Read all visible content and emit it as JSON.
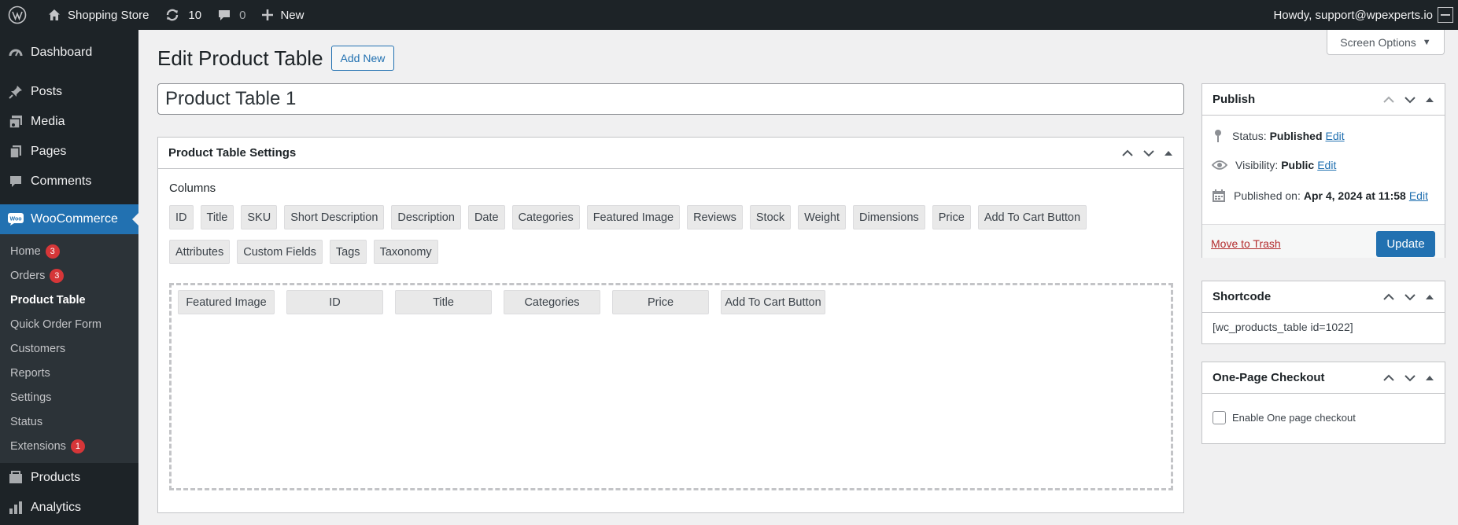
{
  "adminbar": {
    "site_name": "Shopping Store",
    "updates_count": "10",
    "comments_count": "0",
    "new_label": "New",
    "howdy": "Howdy, support@wpexperts.io"
  },
  "sidebar": {
    "items": [
      {
        "label": "Dashboard",
        "icon": "dashboard-icon"
      },
      {
        "label": "Posts",
        "icon": "pin-icon"
      },
      {
        "label": "Media",
        "icon": "media-icon"
      },
      {
        "label": "Pages",
        "icon": "pages-icon"
      },
      {
        "label": "Comments",
        "icon": "comment-icon"
      },
      {
        "label": "WooCommerce",
        "icon": "woo-icon"
      },
      {
        "label": "Products",
        "icon": "products-icon"
      },
      {
        "label": "Analytics",
        "icon": "analytics-icon"
      }
    ],
    "submenu": [
      {
        "label": "Home",
        "badge": "3"
      },
      {
        "label": "Orders",
        "badge": "3"
      },
      {
        "label": "Product Table"
      },
      {
        "label": "Quick Order Form"
      },
      {
        "label": "Customers"
      },
      {
        "label": "Reports"
      },
      {
        "label": "Settings"
      },
      {
        "label": "Status"
      },
      {
        "label": "Extensions",
        "badge": "1"
      }
    ]
  },
  "screen_options": "Screen Options",
  "page": {
    "title": "Edit Product Table",
    "add_new": "Add New",
    "post_title": "Product Table 1"
  },
  "settings": {
    "header": "Product Table Settings",
    "columns_label": "Columns",
    "available_row1": [
      "ID",
      "Title",
      "SKU",
      "Short Description",
      "Description",
      "Date",
      "Categories",
      "Featured Image",
      "Reviews",
      "Stock",
      "Weight",
      "Dimensions",
      "Price",
      "Add To Cart Button"
    ],
    "available_row2": [
      "Attributes",
      "Custom Fields",
      "Tags",
      "Taxonomy"
    ],
    "selected": [
      "Featured Image",
      "ID",
      "Title",
      "Categories",
      "Price",
      "Add To Cart Button"
    ]
  },
  "publish": {
    "header": "Publish",
    "status_label": "Status:",
    "status_value": "Published",
    "visibility_label": "Visibility:",
    "visibility_value": "Public",
    "published_label": "Published on:",
    "published_value": "Apr 4, 2024 at 11:58",
    "edit": "Edit",
    "trash": "Move to Trash",
    "update": "Update"
  },
  "shortcode": {
    "header": "Shortcode",
    "value": "[wc_products_table id=1022]"
  },
  "onepage": {
    "header": "One-Page Checkout",
    "checkbox_label": "Enable One page checkout",
    "checked": false
  },
  "colors": {
    "admin_dark": "#1d2327",
    "accent": "#2271b1",
    "badge": "#d63638"
  }
}
